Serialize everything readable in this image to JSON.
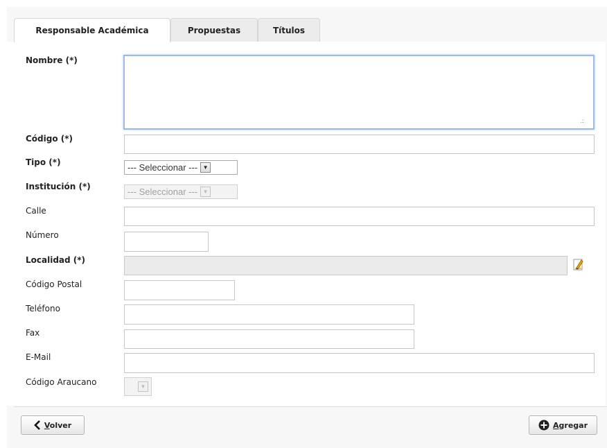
{
  "tabs": [
    {
      "label": "Responsable Académica",
      "active": true
    },
    {
      "label": "Propuestas",
      "active": false
    },
    {
      "label": "Títulos",
      "active": false
    }
  ],
  "form": {
    "nombre": {
      "label": "Nombre (*)",
      "value": ""
    },
    "codigo": {
      "label": "Código (*)",
      "value": ""
    },
    "tipo": {
      "label": "Tipo (*)",
      "selected": "--- Seleccionar ---"
    },
    "institucion": {
      "label": "Institución (*)",
      "selected": "--- Seleccionar ---"
    },
    "calle": {
      "label": "Calle",
      "value": ""
    },
    "numero": {
      "label": "Número",
      "value": ""
    },
    "localidad": {
      "label": "Localidad (*)",
      "value": ""
    },
    "codigo_postal": {
      "label": "Código Postal",
      "value": ""
    },
    "telefono": {
      "label": "Teléfono",
      "value": ""
    },
    "fax": {
      "label": "Fax",
      "value": ""
    },
    "email": {
      "label": "E-Mail",
      "value": ""
    },
    "codigo_araucano": {
      "label": "Código Araucano",
      "selected": ""
    }
  },
  "buttons": {
    "volver": {
      "accesskey": "V",
      "rest": "olver"
    },
    "agregar": {
      "accesskey": "A",
      "rest": "gregar"
    }
  },
  "icons": {
    "back": "chevron-left-icon",
    "add": "plus-circle-icon",
    "edit": "pencil-icon"
  },
  "colors": {
    "focus_border": "#9fb9e3",
    "disabled_bg": "#ebebeb"
  }
}
